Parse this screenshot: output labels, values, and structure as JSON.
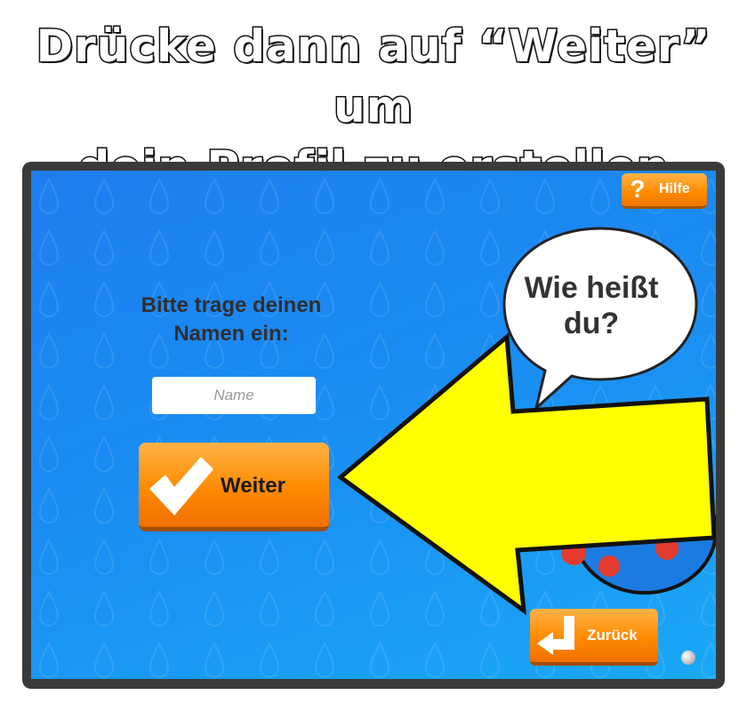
{
  "headline": {
    "line1": "Drücke dann auf “Weiter” um",
    "line2": "dein Profil zu erstellen"
  },
  "app": {
    "help_button": {
      "icon": "question-icon",
      "glyph": "?",
      "label": "Hilfe"
    },
    "prompt": {
      "line1": "Bitte trage deinen",
      "line2": "Namen ein:"
    },
    "name_input": {
      "value": "",
      "placeholder": "Name"
    },
    "weiter_button": {
      "icon": "checkmark-icon",
      "label": "Weiter"
    },
    "speech_bubble": {
      "line1": "Wie heißt",
      "line2": "du?"
    },
    "zurueck_button": {
      "icon": "back-arrow-icon",
      "label": "Zurück"
    },
    "annotation_arrow": {
      "icon": "pointer-arrow-icon",
      "color": "#ffff00",
      "points_to": "weiter_button"
    }
  },
  "colors": {
    "screen_blue": "#1a8cf2",
    "button_orange": "#ff8a00",
    "frame": "#3a3a3a",
    "highlight_arrow": "#ffff00"
  }
}
